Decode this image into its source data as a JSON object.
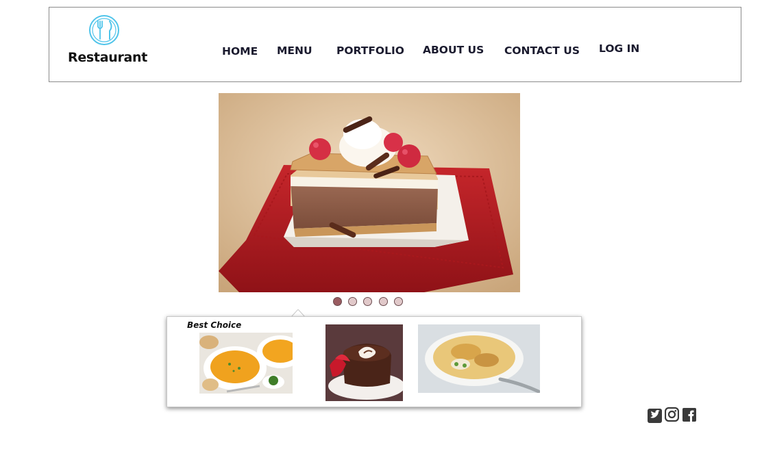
{
  "brand": {
    "name": "Restaurant",
    "icon": "fork-knife-plate-icon",
    "accent": "#4fc4ea"
  },
  "nav": {
    "home": "HOME",
    "menu": "MENU",
    "portfolio": "PORTFOLIO",
    "about": "ABOUT US",
    "contact": "CONTACT US",
    "login": "LOG IN"
  },
  "slider": {
    "current_image": "chocolate-cream-cake-slice",
    "dots_total": 5,
    "active_dot": 1
  },
  "featured": {
    "title": "Best Choice",
    "items": [
      "pumpkin-soup",
      "chocolate-lava-cake",
      "fish-pie"
    ]
  },
  "social": [
    "twitter-icon",
    "instagram-icon",
    "facebook-icon"
  ],
  "colors": {
    "dot_active": "#9a5c61",
    "dot_inactive": "#e1c9ca",
    "nav_text": "#1a1a2e"
  }
}
